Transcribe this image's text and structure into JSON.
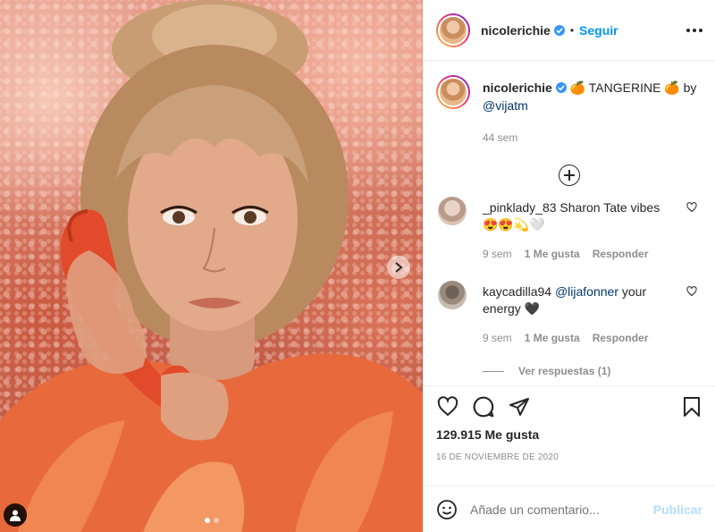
{
  "post": {
    "username": "nicolerichie",
    "follow_label": "Seguir",
    "separator": "•",
    "more_icon": "more-options-icon"
  },
  "caption": {
    "username": "nicolerichie",
    "text_before": "🍊 TANGERINE 🍊 by ",
    "mention": "@vijatm",
    "time": "44 sem"
  },
  "comments": [
    {
      "username": "_pinklady_83",
      "text": "Sharon Tate vibes",
      "emoji_line": "😍😍💫🤍",
      "time": "9 sem",
      "likes": "1 Me gusta",
      "reply": "Responder"
    },
    {
      "username": "kaycadilla94",
      "mention": "@lijafonner",
      "text": "your energy 🖤",
      "time": "9 sem",
      "likes": "1 Me gusta",
      "reply": "Responder",
      "view_replies": "Ver respuestas (1)"
    }
  ],
  "actions": {
    "likes_count": "129.915 Me gusta",
    "date": "16 DE NOVIEMBRE DE 2020"
  },
  "composer": {
    "placeholder": "Añade un comentario...",
    "publish_label": "Publicar"
  },
  "colors": {
    "link": "#0095f6",
    "mention": "#00376b",
    "muted": "#8e8e8e",
    "publish_disabled": "#b2dffc"
  },
  "carousel": {
    "count": 2,
    "active_index": 0
  }
}
